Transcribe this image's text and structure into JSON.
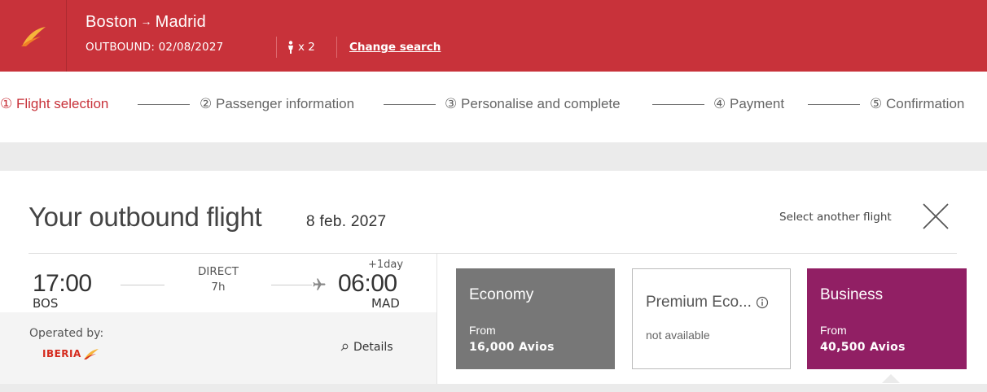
{
  "header": {
    "origin": "Boston",
    "arrow": "→",
    "destination": "Madrid",
    "outbound_label": "OUTBOUND: 02/08/2027",
    "passenger_count": "x 2",
    "change_search": "Change search",
    "accent_color": "#c8323a"
  },
  "steps": [
    {
      "num": "①",
      "label": "Flight selection",
      "active": true
    },
    {
      "num": "②",
      "label": "Passenger information",
      "active": false
    },
    {
      "num": "③",
      "label": "Personalise and complete",
      "active": false
    },
    {
      "num": "④",
      "label": "Payment",
      "active": false
    },
    {
      "num": "⑤",
      "label": "Confirmation",
      "active": false
    }
  ],
  "card": {
    "title": "Your outbound flight",
    "date": "8 feb. 2027",
    "select_another": "Select another flight"
  },
  "flight": {
    "departure_time": "17:00",
    "departure_code": "BOS",
    "stops": "DIRECT",
    "duration": "7h",
    "plus_day": "+1day",
    "arrival_time": "06:00",
    "arrival_code": "MAD",
    "operated_by": "Operated by:",
    "carrier_logo_text": "IBERIA",
    "details": "Details"
  },
  "fares": {
    "economy": {
      "name": "Economy",
      "from": "From",
      "price": "16,000 Avios",
      "color": "#777777"
    },
    "premium": {
      "name": "Premium Eco...",
      "status": "not available"
    },
    "business": {
      "name": "Business",
      "from": "From",
      "price": "40,500 Avios",
      "color": "#911f64"
    }
  }
}
